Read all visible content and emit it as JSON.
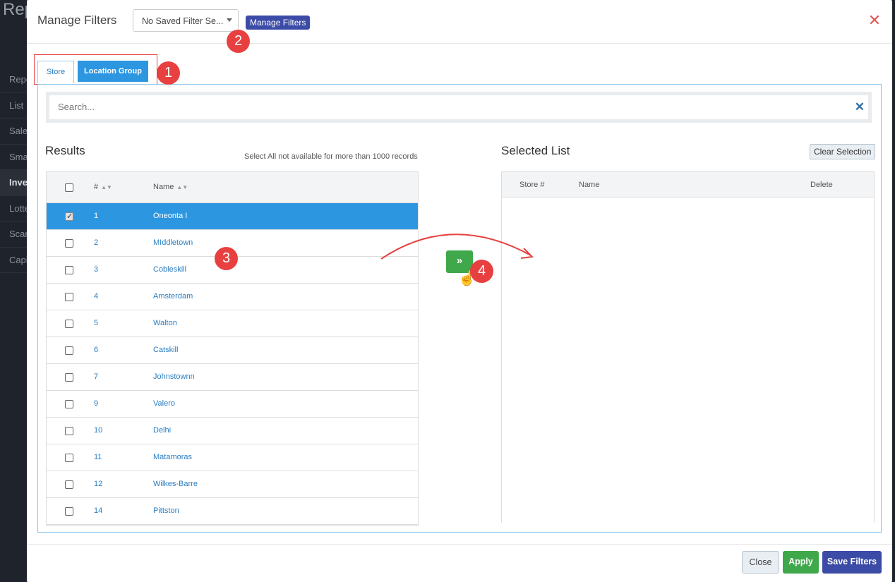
{
  "background": {
    "app_title": "Rep",
    "nav_items": [
      {
        "label": "Repo",
        "active": false
      },
      {
        "label": "List",
        "active": false
      },
      {
        "label": "Sale",
        "active": false
      },
      {
        "label": "Sma",
        "active": false
      },
      {
        "label": "Inve",
        "active": true
      },
      {
        "label": "Lotte",
        "active": false
      },
      {
        "label": "Scan",
        "active": false
      },
      {
        "label": "Capi",
        "active": false
      }
    ]
  },
  "modal": {
    "title": "Manage Filters",
    "saved_filter_value": "No Saved Filter Se...",
    "manage_filters_label": "Manage Filters",
    "close_icon": "close-icon"
  },
  "callouts": [
    "1",
    "2",
    "3",
    "4"
  ],
  "tabs": [
    {
      "label": "Store",
      "active": false
    },
    {
      "label": "Location Group",
      "active": true
    }
  ],
  "search": {
    "placeholder": "Search...",
    "clear_icon": "clear-x-icon"
  },
  "results": {
    "title": "Results",
    "note": "Select All not available for more than 1000 records",
    "columns": [
      "#",
      "Name"
    ],
    "rows": [
      {
        "num": "1",
        "name": "Oneonta I",
        "checked": true
      },
      {
        "num": "2",
        "name": "MIddletown",
        "checked": false
      },
      {
        "num": "3",
        "name": "Cobleskill",
        "checked": false
      },
      {
        "num": "4",
        "name": "Amsterdam",
        "checked": false
      },
      {
        "num": "5",
        "name": "Walton",
        "checked": false
      },
      {
        "num": "6",
        "name": "Catskill",
        "checked": false
      },
      {
        "num": "7",
        "name": "Johnstownn",
        "checked": false
      },
      {
        "num": "9",
        "name": "Valero",
        "checked": false
      },
      {
        "num": "10",
        "name": "Delhi",
        "checked": false
      },
      {
        "num": "11",
        "name": "Matamoras",
        "checked": false
      },
      {
        "num": "12",
        "name": "Wilkes-Barre",
        "checked": false
      },
      {
        "num": "14",
        "name": "Pittston",
        "checked": false
      }
    ]
  },
  "move_button": {
    "label": "»"
  },
  "selected_list": {
    "title": "Selected List",
    "clear_label": "Clear Selection",
    "columns": [
      "Store #",
      "Name",
      "Delete"
    ]
  },
  "footer": {
    "close_label": "Close",
    "apply_label": "Apply",
    "save_label": "Save Filters"
  },
  "colors": {
    "accent_blue": "#2d96e0",
    "primary_indigo": "#3b4ba6",
    "success_green": "#3fa84a",
    "callout_red": "#e84040"
  }
}
